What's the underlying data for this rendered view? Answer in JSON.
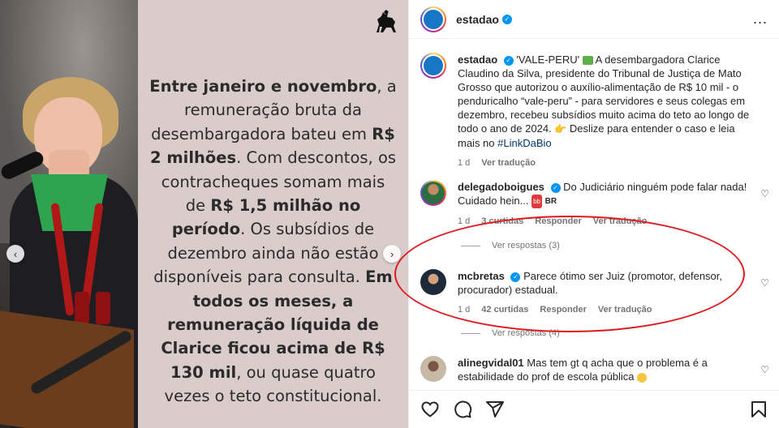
{
  "post": {
    "quote_segments": [
      {
        "text": "Entre janeiro e novembro",
        "bold": true
      },
      {
        "text": ", a remuneração bruta da desembargadora bateu em ",
        "bold": false
      },
      {
        "text": "R$ 2 milhões",
        "bold": true
      },
      {
        "text": ". Com descontos, os contracheques somam mais de ",
        "bold": false
      },
      {
        "text": "R$ 1,5 milhão no período",
        "bold": true
      },
      {
        "text": ". Os subsídios de dezembro ainda não estão disponíveis para consulta. ",
        "bold": false
      },
      {
        "text": "Em todos os meses, a remuneração líquida de Clarice ficou acima de R$ 130 mil",
        "bold": true
      },
      {
        "text": ", ou quase quatro vezes o teto constitucional.",
        "bold": false
      }
    ]
  },
  "header": {
    "username": "estadao",
    "more_label": "..."
  },
  "caption": {
    "username": "estadao",
    "text_before": "'VALE-PERU' ",
    "text_main": " A desembargadora Clarice Claudino da Silva, presidente do Tribunal de Justiça de Mato Grosso que autorizou o auxílio-alimentação de R$ 10 mil - o penduricalho “vale-peru” - para servidores e seus colegas em dezembro, recebeu subsídios muito acima do teto ao longo de todo o ano de 2024. ",
    "text_end": " Deslize para entender o caso e leia mais no ",
    "hashtag": "#LinkDaBio",
    "time": "1 d",
    "translate": "Ver tradução"
  },
  "comments": [
    {
      "username": "delegadoboigues",
      "text": "Do Judiciário ninguém pode falar nada! Cuidado hein...",
      "badge": "BR",
      "time": "1 d",
      "likes": "3 curtidas",
      "reply": "Responder",
      "translate": "Ver tradução",
      "replies": "Ver respostas (3)"
    },
    {
      "username": "mcbretas",
      "text": "Parece ótimo ser Juiz (promotor, defensor, procurador) estadual.",
      "time": "1 d",
      "likes": "42 curtidas",
      "reply": "Responder",
      "translate": "Ver tradução",
      "replies": "Ver respostas (4)"
    },
    {
      "username": "alinegvidal01",
      "text": "Mas tem gt q acha que o problema é a estabilidade do prof de escola pública"
    }
  ],
  "icons": {
    "heart": "heart-icon",
    "comment": "comment-icon",
    "share": "share-icon",
    "bookmark": "bookmark-icon",
    "verified": "verified-badge-icon",
    "chevron_left": "chevron-left-icon",
    "chevron_right": "chevron-right-icon"
  },
  "colors": {
    "verified": "#0095f6",
    "highlight_oval": "#e0191e",
    "link": "#00376b",
    "muted": "#737373",
    "quote_bg": "#d9cccb"
  }
}
